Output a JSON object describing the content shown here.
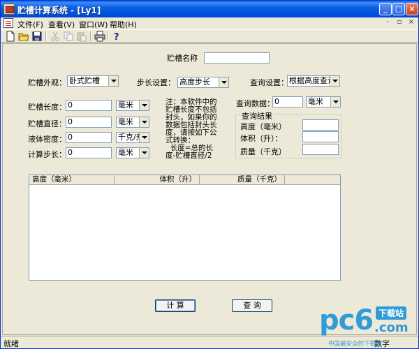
{
  "window": {
    "title": "贮槽计算系统 - [Ly1]",
    "controls": {
      "minimize": "_",
      "maximize": "□",
      "close": "×"
    }
  },
  "menu": {
    "items": [
      {
        "label": "文件(F)"
      },
      {
        "label": "查看(V)"
      },
      {
        "label": "窗口(W)"
      },
      {
        "label": "帮助(H)"
      }
    ],
    "mdi_controls": {
      "minimize": "-",
      "restore": "▫",
      "close": "×"
    }
  },
  "toolbar": {
    "tools": [
      "new-file-icon",
      "open-folder-icon",
      "save-disk-icon",
      "cut-scissors-icon",
      "copy-icon",
      "paste-icon",
      "print-icon",
      "help-question-icon"
    ]
  },
  "form": {
    "tank_name": {
      "label": "贮槽名称",
      "value": ""
    },
    "appearance": {
      "label": "贮槽外观：",
      "value": "卧式贮槽"
    },
    "step_setting": {
      "label": "步长设置：",
      "value": "高度步长"
    },
    "query_setting": {
      "label": "查询设置：",
      "value": "根据高度查询"
    },
    "length": {
      "label": "贮槽长度：",
      "value": "0",
      "unit": "毫米"
    },
    "diameter": {
      "label": "贮槽直径：",
      "value": "0",
      "unit": "毫米"
    },
    "density": {
      "label": "液体密度：",
      "value": "0",
      "unit": "千克/升"
    },
    "calc_step": {
      "label": "计算步长：",
      "value": "0",
      "unit": "毫米"
    },
    "note": "注：本软件中的贮槽长度不包括封头，如果你的数据包括封头长度，请按如下公式转换：\n  长度=总的长度-贮槽直径/2",
    "query_data": {
      "label": "查询数据：",
      "value": "0",
      "unit": "毫米"
    },
    "result": {
      "legend": "查询结果",
      "height": {
        "label": "高度（毫米）",
        "value": ""
      },
      "volume": {
        "label": "体积（升）：",
        "value": ""
      },
      "mass": {
        "label": "质量（千克）",
        "value": ""
      }
    }
  },
  "table": {
    "columns": [
      "高度（毫米）",
      "体积（升）",
      "质量（千克）"
    ],
    "rows": []
  },
  "buttons": {
    "calculate": "计 算",
    "query": "查 询"
  },
  "status": {
    "left": "就绪",
    "right": "数字"
  },
  "watermark": {
    "logo": "pc6",
    "com": ".com",
    "badge": "下载站",
    "sub": "中国最安全的下载站"
  }
}
